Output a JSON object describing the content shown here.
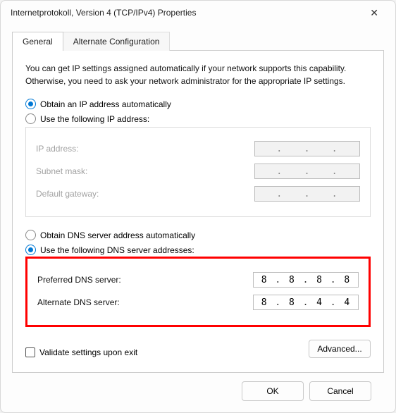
{
  "window": {
    "title": "Internetprotokoll, Version 4 (TCP/IPv4) Properties"
  },
  "tabs": {
    "general": "General",
    "alternate": "Alternate Configuration"
  },
  "description": "You can get IP settings assigned automatically if your network supports this capability. Otherwise, you need to ask your network administrator for the appropriate IP settings.",
  "ip": {
    "auto_label": "Obtain an IP address automatically",
    "manual_label": "Use the following IP address:",
    "auto_selected": true,
    "ip_address_label": "IP address:",
    "subnet_label": "Subnet mask:",
    "gateway_label": "Default gateway:",
    "ip_address_value": "",
    "subnet_value": "",
    "gateway_value": ""
  },
  "dns": {
    "auto_label": "Obtain DNS server address automatically",
    "manual_label": "Use the following DNS server addresses:",
    "auto_selected": false,
    "preferred_label": "Preferred DNS server:",
    "alternate_label": "Alternate DNS server:",
    "preferred_value": [
      "8",
      "8",
      "8",
      "8"
    ],
    "alternate_value": [
      "8",
      "8",
      "4",
      "4"
    ]
  },
  "validate_label": "Validate settings upon exit",
  "advanced_label": "Advanced...",
  "buttons": {
    "ok": "OK",
    "cancel": "Cancel"
  }
}
